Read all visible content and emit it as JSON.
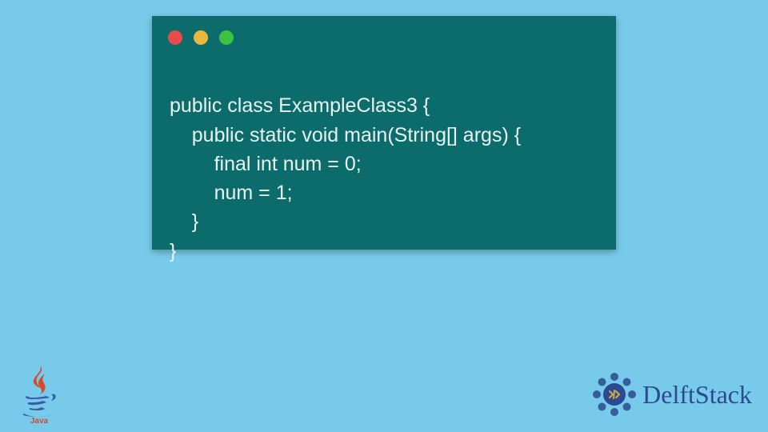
{
  "code": {
    "lines": [
      "public class ExampleClass3 {",
      "    public static void main(String[] args) {",
      "        final int num = 0;",
      "        num = 1;",
      "    }",
      "}"
    ]
  },
  "logos": {
    "java_label": "Java",
    "delft_label": "DelftStack"
  },
  "colors": {
    "bg": "#78caea",
    "window": "#0c6b6b",
    "red": "#e94b4b",
    "yellow": "#eab73e",
    "green": "#3ec33e",
    "delft_blue": "#2b4a8f"
  }
}
